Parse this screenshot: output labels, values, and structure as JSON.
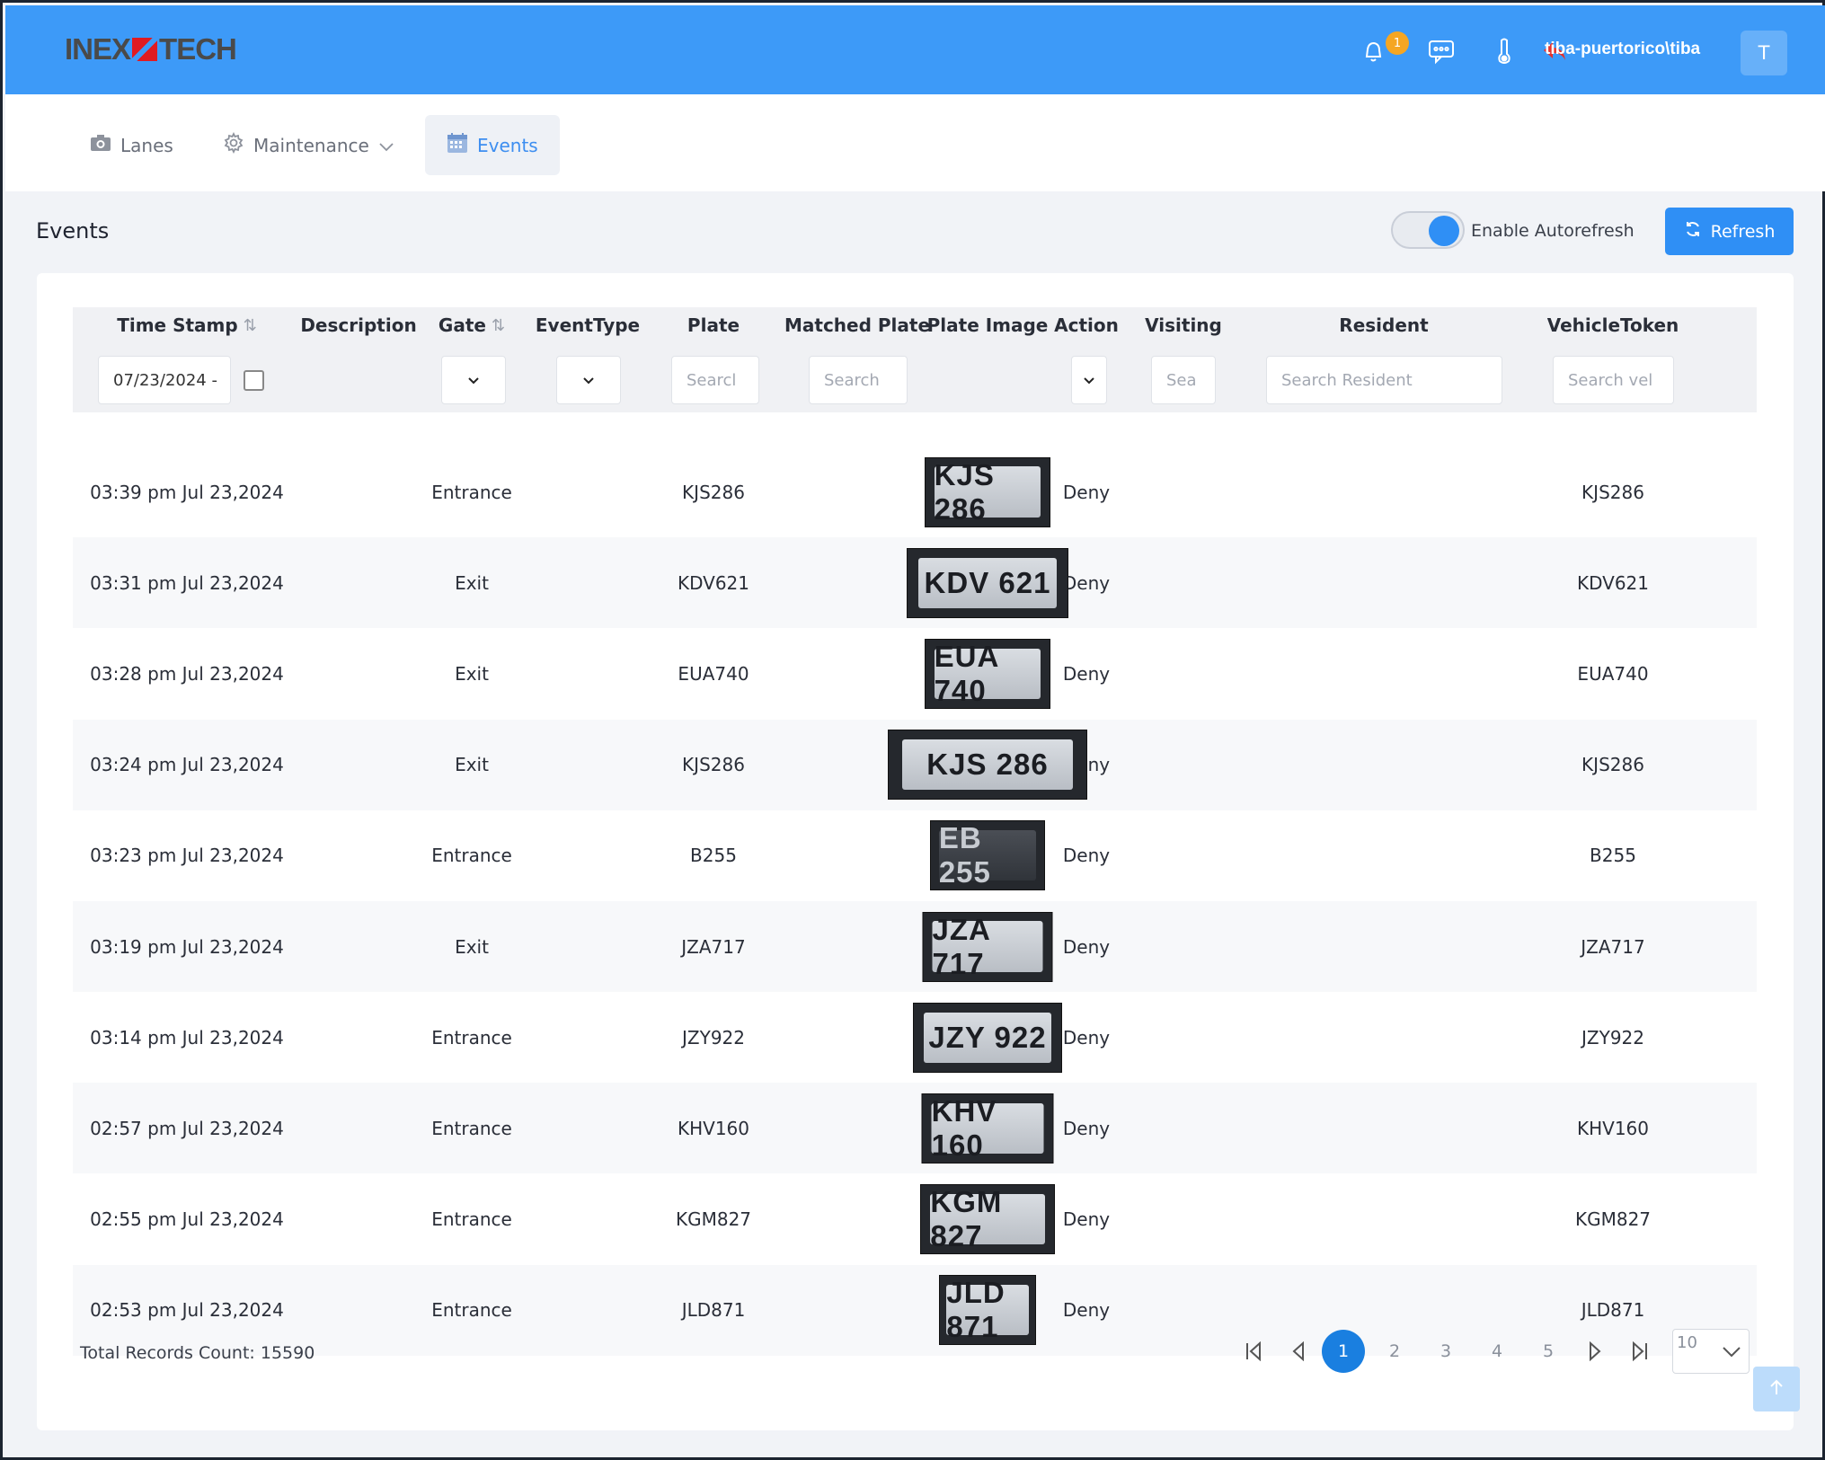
{
  "header": {
    "logo_left": "INEX",
    "logo_right": "TECH",
    "notification_count": "1",
    "user_name": "tiba-puertorico\\tiba",
    "avatar_initial": "T"
  },
  "nav": {
    "lanes": "Lanes",
    "maintenance": "Maintenance",
    "events": "Events"
  },
  "page": {
    "title": "Events",
    "autorefresh_label": "Enable Autorefresh",
    "autorefresh_on": true,
    "refresh_label": "Refresh"
  },
  "columns": {
    "timestamp": "Time Stamp",
    "description": "Description",
    "gate": "Gate",
    "eventtype": "EventType",
    "plate": "Plate",
    "matched_plate": "Matched Plate",
    "plate_image": "Plate Image",
    "action": "Action",
    "visiting": "Visiting",
    "resident": "Resident",
    "vehicletoken": "VehicleToken"
  },
  "filters": {
    "date_value": "07/23/2024 -",
    "plate_placeholder": "Searcl",
    "matched_plate_placeholder": "Search",
    "visiting_placeholder": "Sea",
    "resident_placeholder": "Search Resident",
    "vehicletoken_placeholder": "Search vel"
  },
  "rows": [
    {
      "timestamp": "03:39 pm Jul 23,2024",
      "gate": "Entrance",
      "plate": "KJS286",
      "image_text": "KJS 286",
      "action": "Deny",
      "token": "KJS286"
    },
    {
      "timestamp": "03:31 pm Jul 23,2024",
      "gate": "Exit",
      "plate": "KDV621",
      "image_text": "KDV 621",
      "action": "Deny",
      "token": "KDV621"
    },
    {
      "timestamp": "03:28 pm Jul 23,2024",
      "gate": "Exit",
      "plate": "EUA740",
      "image_text": "EUA 740",
      "action": "Deny",
      "token": "EUA740"
    },
    {
      "timestamp": "03:24 pm Jul 23,2024",
      "gate": "Exit",
      "plate": "KJS286",
      "image_text": "KJS 286",
      "action": "Deny",
      "token": "KJS286"
    },
    {
      "timestamp": "03:23 pm Jul 23,2024",
      "gate": "Entrance",
      "plate": "B255",
      "image_text": "EB 255",
      "action": "Deny",
      "token": "B255"
    },
    {
      "timestamp": "03:19 pm Jul 23,2024",
      "gate": "Exit",
      "plate": "JZA717",
      "image_text": "JZA 717",
      "action": "Deny",
      "token": "JZA717"
    },
    {
      "timestamp": "03:14 pm Jul 23,2024",
      "gate": "Entrance",
      "plate": "JZY922",
      "image_text": "JZY 922",
      "action": "Deny",
      "token": "JZY922"
    },
    {
      "timestamp": "02:57 pm Jul 23,2024",
      "gate": "Entrance",
      "plate": "KHV160",
      "image_text": "KHV 160",
      "action": "Deny",
      "token": "KHV160"
    },
    {
      "timestamp": "02:55 pm Jul 23,2024",
      "gate": "Entrance",
      "plate": "KGM827",
      "image_text": "KGM 827",
      "action": "Deny",
      "token": "KGM827"
    },
    {
      "timestamp": "02:53 pm Jul 23,2024",
      "gate": "Entrance",
      "plate": "JLD871",
      "image_text": "JLD 871",
      "action": "Deny",
      "token": "JLD871"
    }
  ],
  "footer": {
    "total_records": "Total Records Count: 15590",
    "pages": [
      "1",
      "2",
      "3",
      "4",
      "5"
    ],
    "current_page": "1",
    "page_size": "10"
  },
  "icons": {
    "notification": "bell-icon",
    "chat": "chat-icon",
    "temperature": "thermometer-icon",
    "logout": "logout-arrow-icon",
    "lanes": "camera-icon",
    "maintenance": "gear-icon",
    "events": "calendar-icon",
    "refresh": "refresh-icon",
    "sort": "sort-icon",
    "first_page": "first-page-icon",
    "prev_page": "prev-page-icon",
    "next_page": "next-page-icon",
    "last_page": "last-page-icon",
    "scroll_top": "arrow-up-icon"
  },
  "colors": {
    "header_bg": "#3d9af8",
    "accent": "#2f8ff5",
    "active_page": "#1a7fe0",
    "badge": "#f5a623",
    "logo_red": "#e01b22"
  }
}
